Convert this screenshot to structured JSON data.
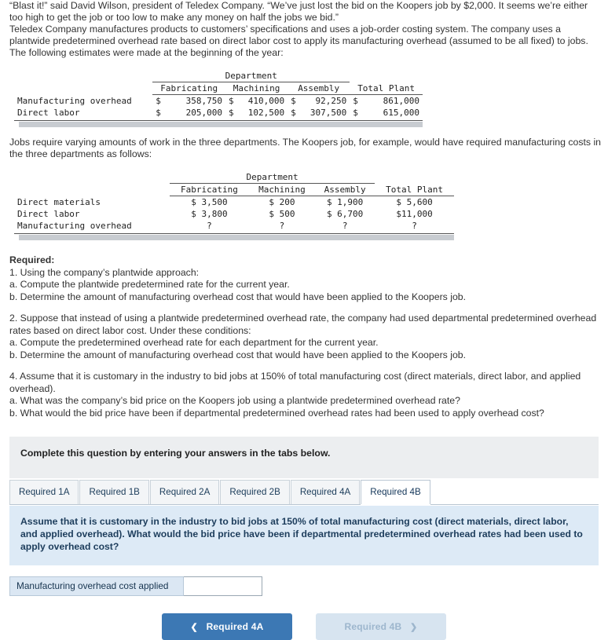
{
  "quote": "“Blast it!” said David Wilson, president of Teledex Company. “We’ve just lost the bid on the Koopers job by $2,000. It seems we’re either too high to get the job or too low to make any money on half the jobs we bid.”",
  "intro": "Teledex Company manufactures products to customers’ specifications and uses a job-order costing system. The company uses a plantwide predetermined overhead rate based on direct labor cost to apply its manufacturing overhead (assumed to be all fixed) to jobs. The following estimates were made at the beginning of the year:",
  "table1": {
    "group_header": "Department",
    "columns": [
      "Fabricating",
      "Machining",
      "Assembly",
      "Total Plant"
    ],
    "rows": [
      {
        "label": "Manufacturing overhead",
        "cells": [
          {
            "cur": "$",
            "val": "358,750"
          },
          {
            "cur": "$",
            "val": "410,000"
          },
          {
            "cur": "$",
            "val": "92,250"
          },
          {
            "cur": "$",
            "val": "861,000"
          }
        ]
      },
      {
        "label": "Direct labor",
        "cells": [
          {
            "cur": "$",
            "val": "205,000"
          },
          {
            "cur": "$",
            "val": "102,500"
          },
          {
            "cur": "$",
            "val": "307,500"
          },
          {
            "cur": "$",
            "val": "615,000"
          }
        ]
      }
    ]
  },
  "para2": "Jobs require varying amounts of work in the three departments. The Koopers job, for example, would have required manufacturing costs in the three departments as follows:",
  "table2": {
    "group_header": "Department",
    "columns": [
      "Fabricating",
      "Machining",
      "Assembly",
      "Total Plant"
    ],
    "rows": [
      {
        "label": "Direct materials",
        "cells": [
          "$ 3,500",
          "$ 200",
          "$ 1,900",
          "$ 5,600"
        ]
      },
      {
        "label": "Direct labor",
        "cells": [
          "$ 3,800",
          "$ 500",
          "$ 6,700",
          "$11,000"
        ]
      },
      {
        "label": "Manufacturing overhead",
        "cells": [
          "?",
          "?",
          "?",
          "?"
        ]
      }
    ]
  },
  "required": {
    "heading": "Required:",
    "lines": [
      "1. Using the company’s plantwide approach:",
      "a. Compute the plantwide predetermined rate for the current year.",
      "b. Determine the amount of manufacturing overhead cost that would have been applied to the Koopers job."
    ],
    "block2": [
      "2. Suppose that instead of using a plantwide predetermined overhead rate, the company had used departmental predetermined overhead rates based on direct labor cost. Under these conditions:",
      "a. Compute the predetermined overhead rate for each department for the current year.",
      "b. Determine the amount of manufacturing overhead cost that would have been applied to the Koopers job."
    ],
    "block4": [
      "4. Assume that it is customary in the industry to bid jobs at 150% of total manufacturing cost (direct materials, direct labor, and applied overhead).",
      "a. What was the company’s bid price on the Koopers job using a plantwide predetermined overhead rate?",
      "b. What would the bid price have been if departmental predetermined overhead rates had been used to apply overhead cost?"
    ]
  },
  "instruction": "Complete this question by entering your answers in the tabs below.",
  "tabs": [
    {
      "label": "Required 1A",
      "active": false
    },
    {
      "label": "Required 1B",
      "active": false
    },
    {
      "label": "Required 2A",
      "active": false
    },
    {
      "label": "Required 2B",
      "active": false
    },
    {
      "label": "Required 4A",
      "active": false
    },
    {
      "label": "Required 4B",
      "active": true
    }
  ],
  "panel_text": "Assume that it is customary in the industry to bid jobs at 150% of total manufacturing cost (direct materials, direct labor, and applied overhead). What would the bid price have been if departmental predetermined overhead rates had been used to apply overhead cost?",
  "answer": {
    "label": "Manufacturing overhead cost applied",
    "value": "",
    "placeholder": ""
  },
  "nav": {
    "prev_label": "Required 4A",
    "next_label": "Required 4B",
    "prev_icon": "chevron-left-icon",
    "next_icon": "chevron-right-icon"
  }
}
